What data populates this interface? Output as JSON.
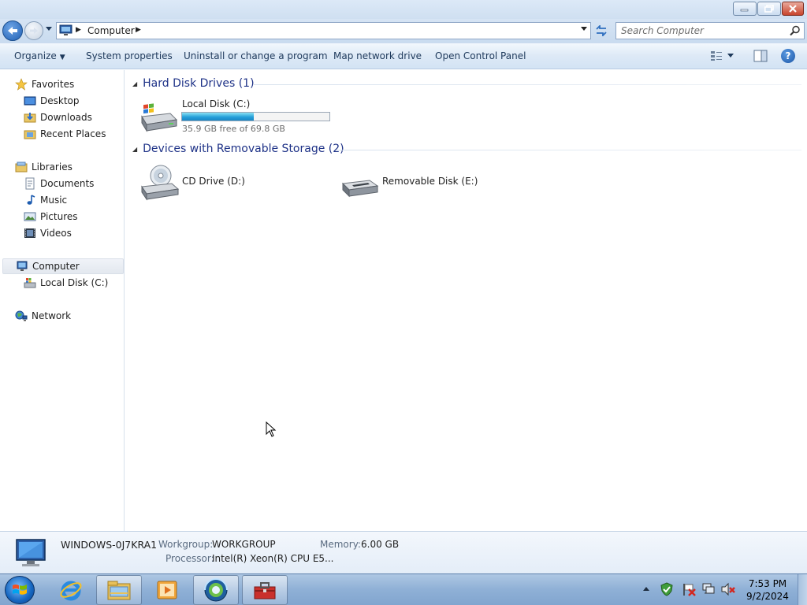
{
  "window": {
    "controls": {
      "minimize_icon": "minimize-icon",
      "restore_icon": "restore-icon",
      "close_icon": "close-icon"
    }
  },
  "address_bar": {
    "path": "Computer",
    "search_placeholder": "Search Computer"
  },
  "command_bar": {
    "organize": "Organize",
    "system_properties": "System properties",
    "uninstall": "Uninstall or change a program",
    "map_drive": "Map network drive",
    "control_panel": "Open Control Panel"
  },
  "nav_pane": {
    "favorites": {
      "label": "Favorites",
      "items": [
        "Desktop",
        "Downloads",
        "Recent Places"
      ]
    },
    "libraries": {
      "label": "Libraries",
      "items": [
        "Documents",
        "Music",
        "Pictures",
        "Videos"
      ]
    },
    "computer": {
      "label": "Computer",
      "items": [
        "Local Disk (C:)"
      ]
    },
    "network": {
      "label": "Network"
    }
  },
  "content": {
    "hard_disks": {
      "title": "Hard Disk Drives (1)",
      "drives": [
        {
          "name": "Local Disk (C:)",
          "free_text": "35.9 GB free of 69.8 GB",
          "used_fraction": 0.486,
          "bar_color": "#26a0da"
        }
      ]
    },
    "removable": {
      "title": "Devices with Removable Storage (2)",
      "devices": [
        {
          "name": "CD Drive (D:)",
          "icon": "cd-drive-icon"
        },
        {
          "name": "Removable Disk (E:)",
          "icon": "removable-disk-icon"
        }
      ]
    }
  },
  "details_pane": {
    "computer_name": "WINDOWS-0J7KRA1",
    "workgroup_label": "Workgroup:",
    "workgroup_value": "WORKGROUP",
    "memory_label": "Memory:",
    "memory_value": "6.00 GB",
    "processor_label": "Processor:",
    "processor_value": "Intel(R) Xeon(R) CPU E5..."
  },
  "taskbar": {
    "pinned": [
      "internet-explorer-icon",
      "windows-explorer-icon",
      "media-player-icon",
      "browser-icon",
      "toolbox-icon"
    ],
    "clock_time": "7:53 PM",
    "clock_date": "9/2/2024"
  }
}
